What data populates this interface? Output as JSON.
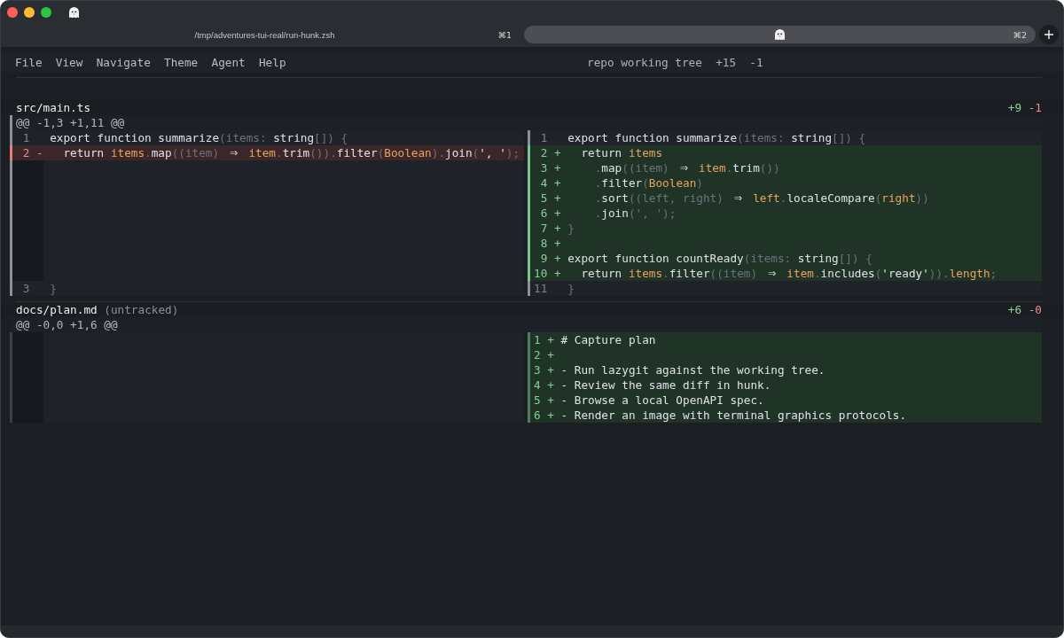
{
  "tabs": [
    {
      "kind": "path",
      "title": "/tmp/adventures-tui-real/run-hunk.zsh",
      "shortcut": "⌘1",
      "selected": false
    },
    {
      "kind": "icon",
      "shortcut": "⌘2",
      "selected": true
    }
  ],
  "menu": [
    "File",
    "View",
    "Navigate",
    "Theme",
    "Agent",
    "Help"
  ],
  "summary": {
    "label": "repo working tree",
    "added": "+15",
    "removed": "-1"
  },
  "files": [
    {
      "path": "src/main.ts",
      "added": "+9",
      "removed": "-1",
      "selected": true,
      "hunk": "@@ -1,3 +1,11 @@",
      "rows": [
        {
          "left": {
            "kind": "context",
            "number": "1",
            "tokens": [
              {
                "text": "export function summarize",
                "kind": "plain"
              },
              {
                "text": "(items: ",
                "kind": "punct"
              },
              {
                "text": "string",
                "kind": "plain"
              },
              {
                "text": "[]) {",
                "kind": "punct"
              }
            ]
          },
          "right": {
            "kind": "context",
            "number": "1",
            "tokens": [
              {
                "text": "export function summarize",
                "kind": "plain"
              },
              {
                "text": "(items: ",
                "kind": "punct"
              },
              {
                "text": "string",
                "kind": "plain"
              },
              {
                "text": "[]) {",
                "kind": "punct"
              }
            ]
          }
        },
        {
          "left": {
            "kind": "removed",
            "number": "2",
            "sign": "-",
            "tokens": [
              {
                "text": "  return ",
                "kind": "plain"
              },
              {
                "text": "items",
                "kind": "name"
              },
              {
                "text": ".",
                "kind": "punct"
              },
              {
                "text": "map",
                "kind": "plain"
              },
              {
                "text": "((item) ",
                "kind": "punct"
              },
              {
                "text": "⇒",
                "kind": "arrow"
              },
              {
                "text": " item",
                "kind": "name"
              },
              {
                "text": ".",
                "kind": "punct"
              },
              {
                "text": "trim",
                "kind": "plain"
              },
              {
                "text": "()).",
                "kind": "punct"
              },
              {
                "text": "filter",
                "kind": "plain"
              },
              {
                "text": "(",
                "kind": "punct"
              },
              {
                "text": "Boolean",
                "kind": "name"
              },
              {
                "text": ").",
                "kind": "punct"
              },
              {
                "text": "join",
                "kind": "plain"
              },
              {
                "text": "(",
                "kind": "punct"
              },
              {
                "text": "', '",
                "kind": "plain"
              },
              {
                "text": ");",
                "kind": "punct"
              }
            ]
          },
          "right": {
            "kind": "added",
            "number": "2",
            "sign": "+",
            "tokens": [
              {
                "text": "  return ",
                "kind": "plain"
              },
              {
                "text": "items",
                "kind": "name"
              }
            ]
          }
        },
        {
          "left": {
            "kind": "filler"
          },
          "right": {
            "kind": "added",
            "number": "3",
            "sign": "+",
            "tokens": [
              {
                "text": "    .",
                "kind": "punct"
              },
              {
                "text": "map",
                "kind": "plain"
              },
              {
                "text": "((item) ",
                "kind": "punct"
              },
              {
                "text": "⇒",
                "kind": "arrow"
              },
              {
                "text": " item",
                "kind": "name"
              },
              {
                "text": ".",
                "kind": "punct"
              },
              {
                "text": "trim",
                "kind": "plain"
              },
              {
                "text": "())",
                "kind": "punct"
              }
            ]
          }
        },
        {
          "left": {
            "kind": "filler"
          },
          "right": {
            "kind": "added",
            "number": "4",
            "sign": "+",
            "tokens": [
              {
                "text": "    .",
                "kind": "punct"
              },
              {
                "text": "filter",
                "kind": "plain"
              },
              {
                "text": "(",
                "kind": "punct"
              },
              {
                "text": "Boolean",
                "kind": "name"
              },
              {
                "text": ")",
                "kind": "punct"
              }
            ]
          }
        },
        {
          "left": {
            "kind": "filler"
          },
          "right": {
            "kind": "added",
            "number": "5",
            "sign": "+",
            "tokens": [
              {
                "text": "    .",
                "kind": "punct"
              },
              {
                "text": "sort",
                "kind": "plain"
              },
              {
                "text": "((left, right) ",
                "kind": "punct"
              },
              {
                "text": "⇒",
                "kind": "arrow"
              },
              {
                "text": " left",
                "kind": "name"
              },
              {
                "text": ".",
                "kind": "punct"
              },
              {
                "text": "localeCompare",
                "kind": "plain"
              },
              {
                "text": "(",
                "kind": "punct"
              },
              {
                "text": "right",
                "kind": "name"
              },
              {
                "text": "))",
                "kind": "punct"
              }
            ]
          }
        },
        {
          "left": {
            "kind": "filler"
          },
          "right": {
            "kind": "added",
            "number": "6",
            "sign": "+",
            "tokens": [
              {
                "text": "    .",
                "kind": "punct"
              },
              {
                "text": "join",
                "kind": "plain"
              },
              {
                "text": "(', ');",
                "kind": "punct"
              }
            ]
          }
        },
        {
          "left": {
            "kind": "filler"
          },
          "right": {
            "kind": "added",
            "number": "7",
            "sign": "+",
            "tokens": [
              {
                "text": "}",
                "kind": "punct"
              }
            ]
          }
        },
        {
          "left": {
            "kind": "filler"
          },
          "right": {
            "kind": "added",
            "number": "8",
            "sign": "+"
          }
        },
        {
          "left": {
            "kind": "filler"
          },
          "right": {
            "kind": "added",
            "number": "9",
            "sign": "+",
            "tokens": [
              {
                "text": "export function countReady",
                "kind": "plain"
              },
              {
                "text": "(items: ",
                "kind": "punct"
              },
              {
                "text": "string",
                "kind": "plain"
              },
              {
                "text": "[]) {",
                "kind": "punct"
              }
            ]
          }
        },
        {
          "left": {
            "kind": "filler"
          },
          "right": {
            "kind": "added",
            "number": "10",
            "sign": "+",
            "tokens": [
              {
                "text": "  return ",
                "kind": "plain"
              },
              {
                "text": "items",
                "kind": "name"
              },
              {
                "text": ".",
                "kind": "punct"
              },
              {
                "text": "filter",
                "kind": "plain"
              },
              {
                "text": "((item) ",
                "kind": "punct"
              },
              {
                "text": "⇒",
                "kind": "arrow"
              },
              {
                "text": " item",
                "kind": "name"
              },
              {
                "text": ".",
                "kind": "punct"
              },
              {
                "text": "includes",
                "kind": "plain"
              },
              {
                "text": "(",
                "kind": "punct"
              },
              {
                "text": "'ready'",
                "kind": "plain"
              },
              {
                "text": ")).",
                "kind": "punct"
              },
              {
                "text": "length",
                "kind": "name"
              },
              {
                "text": ";",
                "kind": "punct"
              }
            ]
          }
        },
        {
          "left": {
            "kind": "context",
            "number": "3",
            "tokens": [
              {
                "text": "}",
                "kind": "punct"
              }
            ]
          },
          "right": {
            "kind": "context",
            "number": "11",
            "tokens": [
              {
                "text": "}",
                "kind": "punct"
              }
            ]
          }
        }
      ]
    },
    {
      "path": "docs/plan.md",
      "note": "(untracked)",
      "added": "+6",
      "removed": "-0",
      "selected": false,
      "hunk": "@@ -0,0 +1,6 @@",
      "rows": [
        {
          "left": {
            "kind": "filler"
          },
          "right": {
            "kind": "added",
            "number": "1",
            "sign": "+",
            "tokens": [
              {
                "text": "# Capture plan",
                "kind": "plain"
              }
            ]
          }
        },
        {
          "left": {
            "kind": "filler"
          },
          "right": {
            "kind": "added",
            "number": "2",
            "sign": "+"
          }
        },
        {
          "left": {
            "kind": "filler"
          },
          "right": {
            "kind": "added",
            "number": "3",
            "sign": "+",
            "tokens": [
              {
                "text": "- Run lazygit against the working tree.",
                "kind": "plain"
              }
            ]
          }
        },
        {
          "left": {
            "kind": "filler"
          },
          "right": {
            "kind": "added",
            "number": "4",
            "sign": "+",
            "tokens": [
              {
                "text": "- Review the same diff in hunk.",
                "kind": "plain"
              }
            ]
          }
        },
        {
          "left": {
            "kind": "filler"
          },
          "right": {
            "kind": "added",
            "number": "5",
            "sign": "+",
            "tokens": [
              {
                "text": "- Browse a local OpenAPI spec.",
                "kind": "plain"
              }
            ]
          }
        },
        {
          "left": {
            "kind": "filler"
          },
          "right": {
            "kind": "added",
            "number": "6",
            "sign": "+",
            "tokens": [
              {
                "text": "- Render an image with terminal graphics protocols.",
                "kind": "plain"
              }
            ]
          }
        }
      ]
    }
  ]
}
